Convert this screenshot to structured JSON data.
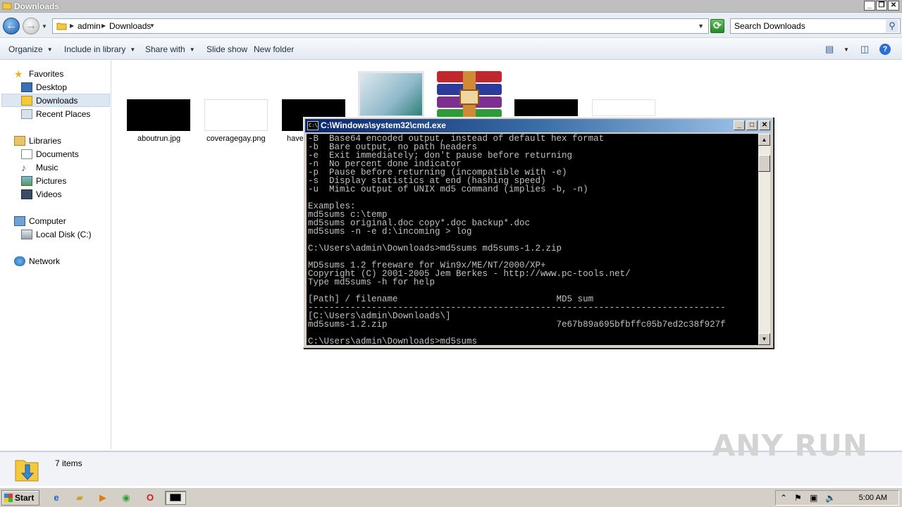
{
  "window": {
    "title": "Downloads"
  },
  "address": {
    "crumbs": [
      "admin",
      "Downloads"
    ]
  },
  "search": {
    "placeholder": "Search Downloads"
  },
  "toolbar": {
    "organize": "Organize",
    "include_in_library": "Include in library",
    "share_with": "Share with",
    "slide_show": "Slide show",
    "new_folder": "New folder"
  },
  "nav": {
    "favorites": "Favorites",
    "desktop": "Desktop",
    "downloads": "Downloads",
    "recent_places": "Recent Places",
    "libraries": "Libraries",
    "documents": "Documents",
    "music": "Music",
    "pictures": "Pictures",
    "videos": "Videos",
    "computer": "Computer",
    "local_disk": "Local Disk (C:)",
    "network": "Network"
  },
  "files": [
    {
      "name": "aboutrun.jpg"
    },
    {
      "name": "coveragegay.png"
    },
    {
      "name": "have"
    }
  ],
  "details": {
    "count": "7 items"
  },
  "watermark": "ANY RUN",
  "cmd": {
    "title": "C:\\Windows\\system32\\cmd.exe",
    "lines": [
      "-B  Base64 encoded output, instead of default hex format",
      "-b  Bare output, no path headers",
      "-e  Exit immediately; don't pause before returning",
      "-n  No percent done indicator",
      "-p  Pause before returning (incompatible with -e)",
      "-s  Display statistics at end (hashing speed)",
      "-u  Mimic output of UNIX md5 command (implies -b, -n)",
      "",
      "Examples:",
      "md5sums c:\\temp",
      "md5sums original.doc copy*.doc backup*.doc",
      "md5sums -n -e d:\\incoming > log",
      "",
      "C:\\Users\\admin\\Downloads>md5sums md5sums-1.2.zip",
      "",
      "MD5sums 1.2 freeware for Win9x/ME/NT/2000/XP+",
      "Copyright (C) 2001-2005 Jem Berkes - http://www.pc-tools.net/",
      "Type md5sums -h for help",
      "",
      "[Path] / filename                              MD5 sum",
      "-------------------------------------------------------------------------------",
      "[C:\\Users\\admin\\Downloads\\]",
      "md5sums-1.2.zip                                7e67b89a695bfbffc05b7ed2c38f927f",
      "",
      "C:\\Users\\admin\\Downloads>md5sums"
    ]
  },
  "taskbar": {
    "start": "Start",
    "clock": "5:00 AM"
  },
  "colors": {
    "cmd_title_start": "#0a246a",
    "cmd_title_end": "#a6caf0",
    "selection": "#dde7f2"
  }
}
